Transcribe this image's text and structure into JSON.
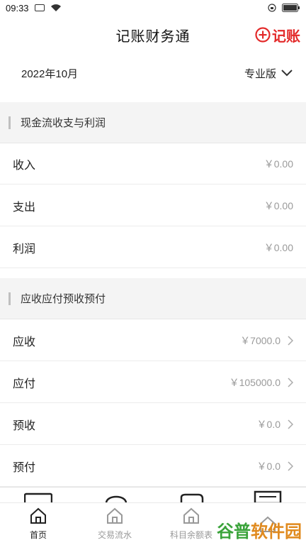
{
  "status_bar": {
    "time": "09:33"
  },
  "header": {
    "title": "记账财务通",
    "record_label": "记账"
  },
  "date_row": {
    "date": "2022年10月",
    "version": "专业版"
  },
  "section_cash": {
    "title": "现金流收支与利润"
  },
  "cash_rows": [
    {
      "label": "收入",
      "value": "￥0.00"
    },
    {
      "label": "支出",
      "value": "￥0.00"
    },
    {
      "label": "利润",
      "value": "￥0.00"
    }
  ],
  "section_ar": {
    "title": "应收应付预收预付"
  },
  "ar_rows": [
    {
      "label": "应收",
      "value": "￥7000.0"
    },
    {
      "label": "应付",
      "value": "￥105000.0"
    },
    {
      "label": "预收",
      "value": "￥0.0"
    },
    {
      "label": "预付",
      "value": "￥0.0"
    }
  ],
  "bottom_nav": {
    "items": [
      {
        "label": "首页",
        "icon": "home-icon"
      },
      {
        "label": "交易流水",
        "icon": "home-icon"
      },
      {
        "label": "科目余额表",
        "icon": "home-icon"
      }
    ]
  },
  "watermark": {
    "part1": "谷普",
    "part2": "软件园"
  },
  "colors": {
    "accent": "#e32a2a",
    "section_bg": "#f4f4f4"
  }
}
